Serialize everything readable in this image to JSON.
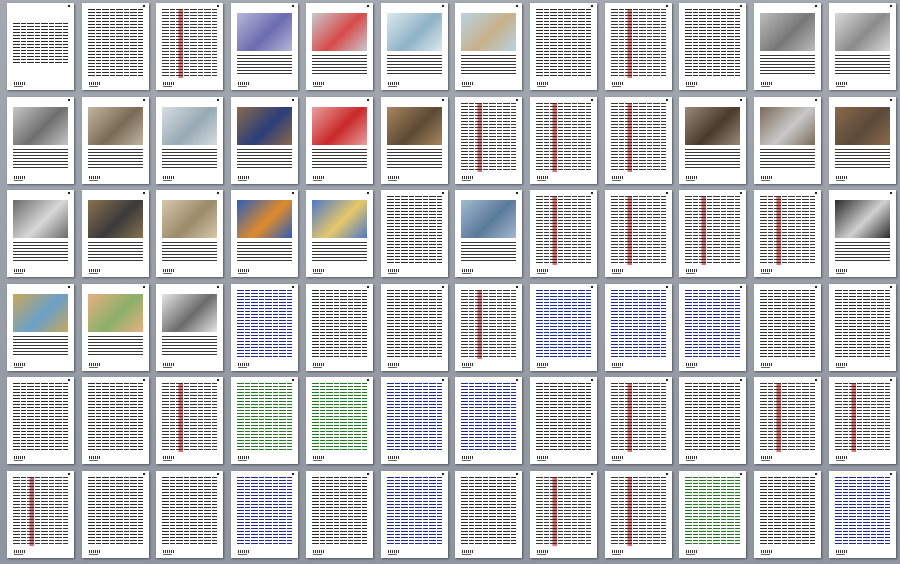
{
  "viewer": {
    "columns": 12,
    "rows": 6,
    "page_count": 72,
    "colors": {
      "background": "#9aa0aa",
      "page": "#ffffff",
      "text": "#141414",
      "link_blue": "#1b2a9a",
      "highlight_red": "#c81414",
      "highlight_green": "#1f7a1f"
    },
    "thumbnails": [
      {
        "kind": "title"
      },
      {
        "kind": "text"
      },
      {
        "kind": "mixed"
      },
      {
        "kind": "photo",
        "color": "#b7b7d8",
        "accent": "#6b6bb0"
      },
      {
        "kind": "photo",
        "color": "#c9c9cf",
        "accent": "#d84a4a"
      },
      {
        "kind": "photo",
        "color": "#dce9ef",
        "accent": "#8fb2c6"
      },
      {
        "kind": "photo",
        "color": "#b9d3e3",
        "accent": "#c7b18a"
      },
      {
        "kind": "text"
      },
      {
        "kind": "mixed"
      },
      {
        "kind": "text"
      },
      {
        "kind": "photo",
        "color": "#bdbdbd",
        "accent": "#777777"
      },
      {
        "kind": "photo",
        "color": "#d9d9d9",
        "accent": "#8b8b8b"
      },
      {
        "kind": "photo",
        "color": "#c7c7c7",
        "accent": "#6e6e6e"
      },
      {
        "kind": "photo",
        "color": "#c2b6a0",
        "accent": "#7a6a55"
      },
      {
        "kind": "photo",
        "color": "#d7dde2",
        "accent": "#97a9b4"
      },
      {
        "kind": "photo",
        "color": "#8a6b4a",
        "accent": "#2b3d7a"
      },
      {
        "kind": "photo",
        "color": "#e9a0a0",
        "accent": "#c82828"
      },
      {
        "kind": "photo",
        "color": "#a98660",
        "accent": "#5b4a34"
      },
      {
        "kind": "mixed"
      },
      {
        "kind": "mixed"
      },
      {
        "kind": "mixed"
      },
      {
        "kind": "photo",
        "color": "#9a8a7a",
        "accent": "#4a3a2a"
      },
      {
        "kind": "photo",
        "color": "#7a6a5a",
        "accent": "#c9c9c9"
      },
      {
        "kind": "photo",
        "color": "#8a6a4a",
        "accent": "#5a4a3a"
      },
      {
        "kind": "photo",
        "color": "#6a6a6a",
        "accent": "#d8d8d8"
      },
      {
        "kind": "photo",
        "color": "#8a7250",
        "accent": "#3a3a3a"
      },
      {
        "kind": "photo",
        "color": "#d7c8aa",
        "accent": "#9a8a6a"
      },
      {
        "kind": "photo",
        "color": "#2b5fb8",
        "accent": "#e08a2a"
      },
      {
        "kind": "photo",
        "color": "#4d78c8",
        "accent": "#e6c86a"
      },
      {
        "kind": "text"
      },
      {
        "kind": "photo",
        "color": "#a3b9cf",
        "accent": "#5a7a9a"
      },
      {
        "kind": "mixed"
      },
      {
        "kind": "mixed"
      },
      {
        "kind": "mixed"
      },
      {
        "kind": "mixed"
      },
      {
        "kind": "photo",
        "color": "#2a2a2a",
        "accent": "#d0d0d0"
      },
      {
        "kind": "photo",
        "color": "#c8a85a",
        "accent": "#6aa0c8"
      },
      {
        "kind": "photo",
        "color": "#e8b080",
        "accent": "#8ab06a"
      },
      {
        "kind": "photo",
        "color": "#e6e6e6",
        "accent": "#6a6a6a"
      },
      {
        "kind": "blue"
      },
      {
        "kind": "text"
      },
      {
        "kind": "text"
      },
      {
        "kind": "mixed"
      },
      {
        "kind": "blue"
      },
      {
        "kind": "blue"
      },
      {
        "kind": "blue"
      },
      {
        "kind": "text"
      },
      {
        "kind": "text"
      },
      {
        "kind": "text"
      },
      {
        "kind": "text"
      },
      {
        "kind": "mixed"
      },
      {
        "kind": "green"
      },
      {
        "kind": "green"
      },
      {
        "kind": "blue"
      },
      {
        "kind": "blue"
      },
      {
        "kind": "text"
      },
      {
        "kind": "mixed"
      },
      {
        "kind": "text"
      },
      {
        "kind": "mixed"
      },
      {
        "kind": "mixed"
      },
      {
        "kind": "mixed"
      },
      {
        "kind": "text"
      },
      {
        "kind": "text"
      },
      {
        "kind": "blue"
      },
      {
        "kind": "text"
      },
      {
        "kind": "blue"
      },
      {
        "kind": "text"
      },
      {
        "kind": "mixed"
      },
      {
        "kind": "mixed"
      },
      {
        "kind": "green"
      },
      {
        "kind": "text"
      },
      {
        "kind": "blue"
      }
    ]
  }
}
